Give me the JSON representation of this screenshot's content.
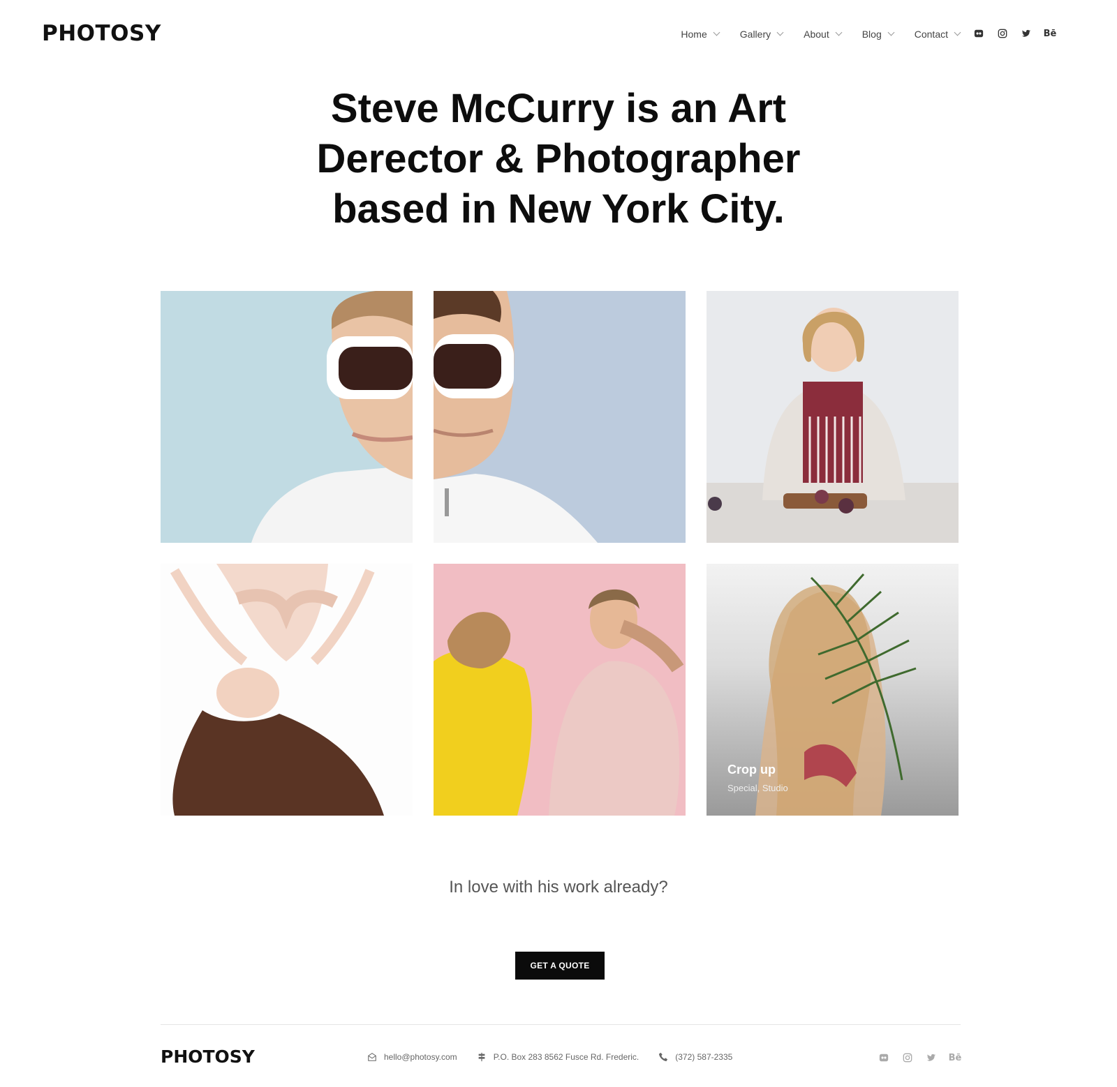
{
  "brand": {
    "logo": "PHOTOSY"
  },
  "nav": {
    "items": [
      {
        "label": "Home"
      },
      {
        "label": "Gallery"
      },
      {
        "label": "About"
      },
      {
        "label": "Blog"
      },
      {
        "label": "Contact"
      }
    ]
  },
  "social": {
    "icons": [
      "flickr-icon",
      "instagram-icon",
      "twitter-icon",
      "behance-icon"
    ],
    "behance_label": "Bē"
  },
  "hero": {
    "line1": "Steve McCurry is an Art",
    "line2": "Derector & Photographer",
    "line3": "based in New York City."
  },
  "gallery": {
    "featured": {
      "title": "Crop up",
      "categories": "Special, Studio"
    },
    "tile_colors": [
      "#c1dbe3",
      "#bccbdd",
      "#e8eaed",
      "#fdfdfd",
      "#f1bdc3",
      "#bdbdbd"
    ]
  },
  "cta": {
    "text": "In love with his work already?",
    "button": "GET A QUOTE"
  },
  "footer": {
    "logo": "PHOTOSY",
    "email": "hello@photosy.com",
    "address": "P.O. Box 283 8562 Fusce Rd. Frederic.",
    "phone": "(372) 587-2335",
    "behance_label": "Bē"
  }
}
